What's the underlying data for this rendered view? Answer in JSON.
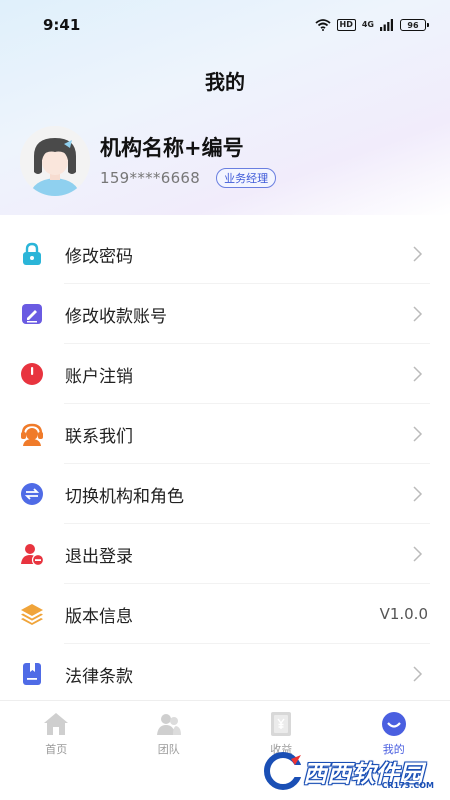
{
  "status_bar": {
    "time": "9:41",
    "hd": "HD",
    "network": "4G",
    "battery": "96"
  },
  "page": {
    "title": "我的"
  },
  "profile": {
    "name": "机构名称+编号",
    "phone": "159****6668",
    "role": "业务经理"
  },
  "menu": [
    {
      "label": "修改密码",
      "icon": "lock-icon",
      "color": "#2bb5d8"
    },
    {
      "label": "修改收款账号",
      "icon": "edit-icon",
      "color": "#6a5be2"
    },
    {
      "label": "账户注销",
      "icon": "power-icon",
      "color": "#e8343f"
    },
    {
      "label": "联系我们",
      "icon": "customer-service-icon",
      "color": "#f07b2a"
    },
    {
      "label": "切换机构和角色",
      "icon": "switch-icon",
      "color": "#4f6be6"
    },
    {
      "label": "退出登录",
      "icon": "logout-user-icon",
      "color": "#e8343f"
    },
    {
      "label": "版本信息",
      "icon": "layers-icon",
      "color": "#f0a43a",
      "value": "V1.0.0"
    },
    {
      "label": "法律条款",
      "icon": "bookmark-icon",
      "color": "#4f6be6"
    }
  ],
  "tabbar": [
    {
      "label": "首页",
      "icon": "home-icon"
    },
    {
      "label": "团队",
      "icon": "team-icon"
    },
    {
      "label": "收益",
      "icon": "earnings-icon"
    },
    {
      "label": "我的",
      "icon": "profile-icon",
      "active": true
    }
  ],
  "watermark": {
    "text": "西西软件园",
    "sub": "CR173.COM"
  },
  "colors": {
    "accent": "#4a5fe0",
    "inactive": "#9a9a9a"
  }
}
